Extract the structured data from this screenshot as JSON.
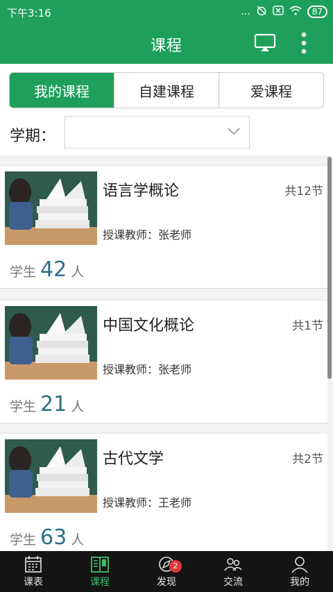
{
  "status_bar": {
    "time": "下午3:16",
    "signal_text": "...",
    "battery": "87"
  },
  "header": {
    "title": "课程"
  },
  "tabs": [
    {
      "label": "我的课程",
      "active": true
    },
    {
      "label": "自建课程",
      "active": false
    },
    {
      "label": "爱课程",
      "active": false
    }
  ],
  "term": {
    "label": "学期：",
    "value": ""
  },
  "courses": [
    {
      "name": "语言学概论",
      "lessons": "共12节",
      "teacher": "授课教师：张老师",
      "students_label": "学生",
      "students_count": "42",
      "students_unit": "人"
    },
    {
      "name": "中国文化概论",
      "lessons": "共1节",
      "teacher": "授课教师：张老师",
      "students_label": "学生",
      "students_count": "21",
      "students_unit": "人"
    },
    {
      "name": "古代文学",
      "lessons": "共2节",
      "teacher": "授课教师：王老师",
      "students_label": "学生",
      "students_count": "63",
      "students_unit": "人"
    }
  ],
  "bottom_nav": [
    {
      "label": "课表",
      "icon": "calendar-icon",
      "active": false
    },
    {
      "label": "课程",
      "icon": "book-icon",
      "active": true
    },
    {
      "label": "发现",
      "icon": "compass-icon",
      "active": false,
      "badge": "2"
    },
    {
      "label": "交流",
      "icon": "people-icon",
      "active": false
    },
    {
      "label": "我的",
      "icon": "person-icon",
      "active": false
    }
  ],
  "colors": {
    "primary": "#1ea05a",
    "nav_bg": "#141414",
    "badge": "#e53935",
    "student_count": "#2c6f86"
  }
}
